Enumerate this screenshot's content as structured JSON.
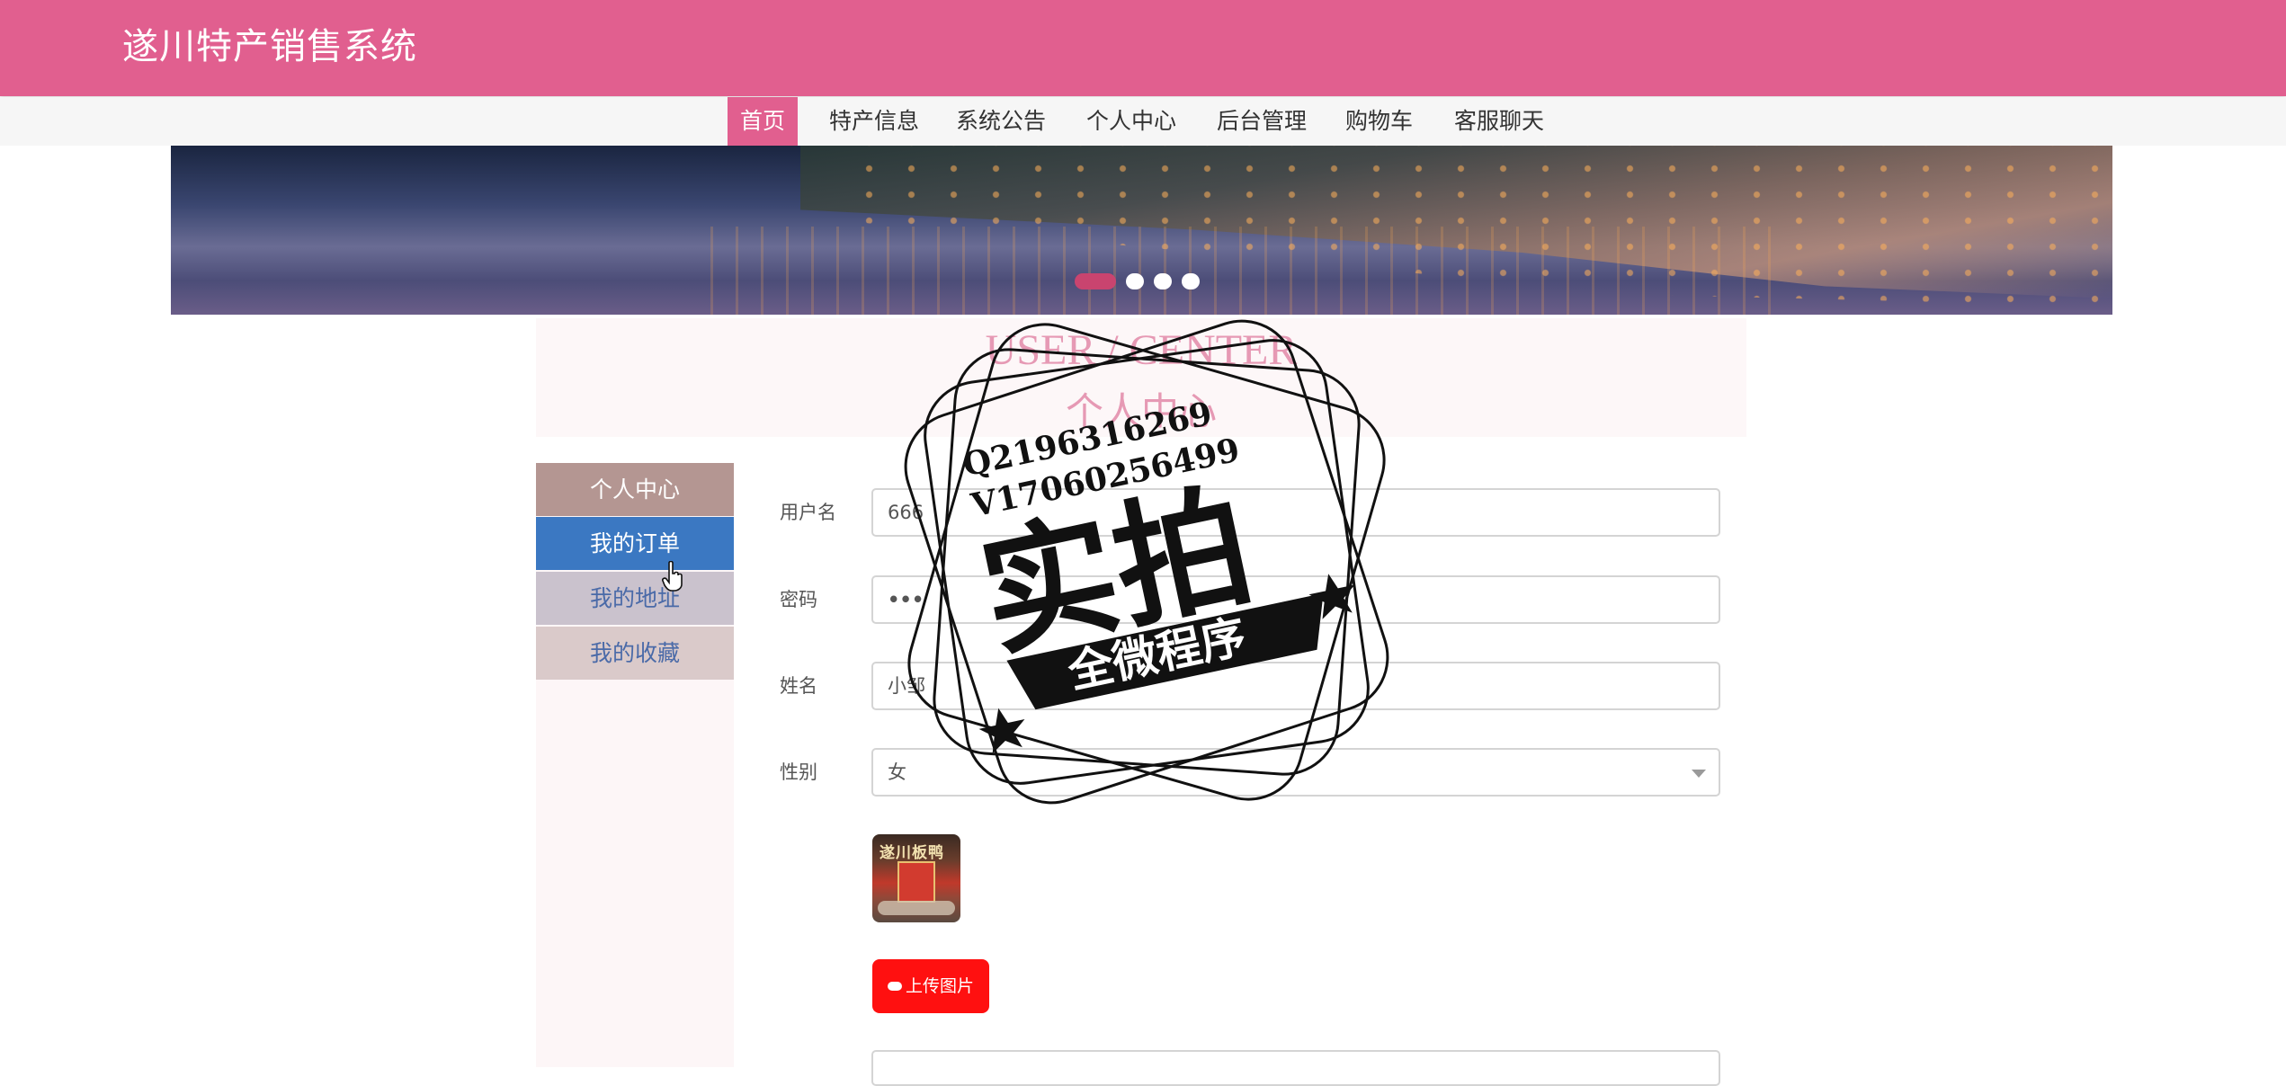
{
  "header": {
    "title": "遂川特产销售系统"
  },
  "nav": {
    "items": [
      {
        "label": "首页",
        "active": true
      },
      {
        "label": "特产信息",
        "active": false
      },
      {
        "label": "系统公告",
        "active": false
      },
      {
        "label": "个人中心",
        "active": false
      },
      {
        "label": "后台管理",
        "active": false
      },
      {
        "label": "购物车",
        "active": false
      },
      {
        "label": "客服聊天",
        "active": false
      }
    ]
  },
  "banner": {
    "active_slide": 1,
    "slide_count": 4
  },
  "section": {
    "en_title": "USER / CENTER",
    "cn_title": "个人中心"
  },
  "sidebar": {
    "items": [
      {
        "label": "个人中心"
      },
      {
        "label": "我的订单"
      },
      {
        "label": "我的地址"
      },
      {
        "label": "我的收藏"
      }
    ]
  },
  "form": {
    "username_label": "用户名",
    "username_value": "666",
    "password_label": "密码",
    "password_value": "•••",
    "name_label": "姓名",
    "name_value": "小邹",
    "gender_label": "性别",
    "gender_value": "女",
    "upload_label": "上传图片"
  },
  "avatar": {
    "text": "遂川板鸭"
  },
  "watermark": {
    "line1": "Q2196316269",
    "line2": "V17060256499",
    "main": "实拍",
    "ribbon": "全微程序"
  },
  "colors": {
    "header": "#e15f8f",
    "nav_active": "#e15f8f",
    "sidebar_active": "#3b78c2",
    "upload_button": "#ff1010"
  },
  "icons": {
    "upload": "cloud-upload-icon",
    "cursor": "hand-pointer-icon"
  }
}
